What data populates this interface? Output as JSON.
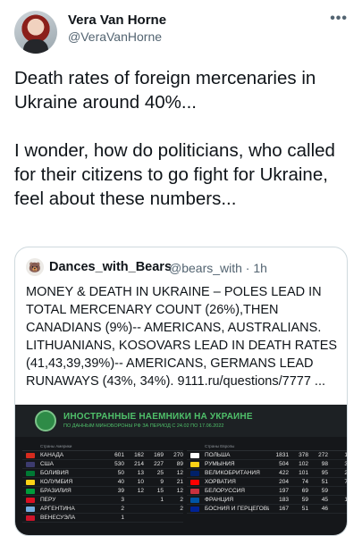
{
  "author": {
    "name": "Vera Van Horne",
    "handle": "@VeraVanHorne"
  },
  "tweet_text": "Death rates of foreign mercenaries in Ukraine around 40%...\n\nI wonder, how do politicians, who called for their citizens to go fight for Ukraine, feel about these numbers...",
  "quoted": {
    "name": "Dances_with_Bears",
    "handle": "@bears_with · 1h",
    "text": "MONEY & DEATH IN UKRAINE – POLES LEAD IN TOTAL MERCENARY COUNT (26%),THEN CANADIANS (9%)-- AMERICANS, AUSTRALIANS. LITHUANIANS, KOSOVARS LEAD IN DEATH RATES (41,43,39,39%)-- AMERICANS,  GERMANS LEAD RUNAWAYS (43%, 34%). 9111.ru/questions/7777 ..."
  },
  "infographic": {
    "title": "ИНОСТРАННЫЕ НАЕМНИКИ НА УКРАИНЕ",
    "subtitle": "ПО ДАННЫМ МИНОБОРОНЫ РФ ЗА ПЕРИОД С 24.02 ПО 17.06.2022",
    "left_header": "Страны Америки",
    "right_header": "Страны Европы",
    "left_rows": [
      {
        "country": "КАНАДА",
        "v": [
          "601",
          "162",
          "169",
          "270"
        ],
        "color": "#d52b1e"
      },
      {
        "country": "США",
        "v": [
          "530",
          "214",
          "227",
          "89"
        ],
        "color": "#3c3b6e"
      },
      {
        "country": "БОЛИВИЯ",
        "v": [
          "50",
          "13",
          "25",
          "12"
        ],
        "color": "#007934"
      },
      {
        "country": "КОЛУМБИЯ",
        "v": [
          "40",
          "10",
          "9",
          "21"
        ],
        "color": "#fcd116"
      },
      {
        "country": "БРАЗИЛИЯ",
        "v": [
          "39",
          "12",
          "15",
          "12"
        ],
        "color": "#009c3b"
      },
      {
        "country": "ПЕРУ",
        "v": [
          "3",
          "",
          "1",
          "2"
        ],
        "color": "#d91023"
      },
      {
        "country": "АРГЕНТИНА",
        "v": [
          "2",
          "",
          "",
          "2"
        ],
        "color": "#74acdf"
      },
      {
        "country": "ВЕНЕСУЭЛА",
        "v": [
          "1",
          "",
          "",
          ""
        ],
        "color": "#cf142b"
      }
    ],
    "right_rows": [
      {
        "country": "ПОЛЬША",
        "v": [
          "1831",
          "378",
          "272",
          "1"
        ],
        "color": "#ffffff"
      },
      {
        "country": "РУМЫНИЯ",
        "v": [
          "504",
          "102",
          "98",
          "3"
        ],
        "color": "#fcd116"
      },
      {
        "country": "ВЕЛИКОБРИТАНИЯ",
        "v": [
          "422",
          "101",
          "95",
          "2"
        ],
        "color": "#012169"
      },
      {
        "country": "ХОРВАТИЯ",
        "v": [
          "204",
          "74",
          "51",
          "7"
        ],
        "color": "#ff0000"
      },
      {
        "country": "БЕЛОРУССИЯ",
        "v": [
          "197",
          "69",
          "59",
          ""
        ],
        "color": "#c8313e"
      },
      {
        "country": "ФРАНЦИЯ",
        "v": [
          "183",
          "59",
          "45",
          "1"
        ],
        "color": "#0055a4"
      },
      {
        "country": "БОСНИЯ И ГЕРЦЕГОВИНА",
        "v": [
          "167",
          "51",
          "46",
          ""
        ],
        "color": "#002395"
      }
    ]
  }
}
